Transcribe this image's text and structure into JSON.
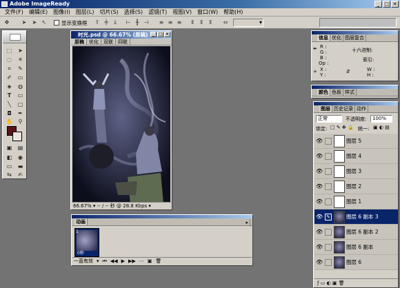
{
  "app": {
    "title": "Adobe ImageReady"
  },
  "menu": [
    "文件(F)",
    "编辑(E)",
    "图像(I)",
    "图层(L)",
    "切片(S)",
    "选择(S)",
    "滤镜(T)",
    "视图(V)",
    "窗口(W)",
    "帮助(H)"
  ],
  "options": {
    "show_transform_label": "显示变换框"
  },
  "document": {
    "title": "时光.psd @ 66.67% (原稿)",
    "tabs": [
      "原稿",
      "优化",
      "双联",
      "四联"
    ],
    "zoom": "66.67%",
    "status": "-- / -- 秒 @ 28.8 Kbps"
  },
  "animation": {
    "title": "动画",
    "frame_number": "1",
    "frame_delay": "0秒",
    "loop": "一直有效"
  },
  "info_panel": {
    "tabs": [
      "信息",
      "优化",
      "图层复合"
    ],
    "labels": {
      "r": "R :",
      "g": "G :",
      "b": "B :",
      "op": "Op :",
      "hex": "十六进制:",
      "index": "索引:",
      "x": "X :",
      "y": "Y :",
      "w": "W :",
      "h": "H :"
    }
  },
  "color_panel": {
    "tabs": [
      "颜色",
      "色板",
      "样式"
    ]
  },
  "layers_panel": {
    "tabs": [
      "图层",
      "历史记录",
      "动作"
    ],
    "blend_mode": "正常",
    "opacity_label": "不透明度:",
    "opacity": "100%",
    "lock_label": "锁定:",
    "unify_label": "统一:",
    "layers": [
      {
        "name": "图层 5",
        "thumb": "light",
        "selected": false
      },
      {
        "name": "图层 4",
        "thumb": "light",
        "selected": false
      },
      {
        "name": "图层 3",
        "thumb": "light",
        "selected": false
      },
      {
        "name": "图层 2",
        "thumb": "light",
        "selected": false
      },
      {
        "name": "图层 1",
        "thumb": "light",
        "selected": false
      },
      {
        "name": "图层 6 副本 3",
        "thumb": "dark",
        "selected": true
      },
      {
        "name": "图层 6 副本 2",
        "thumb": "dark",
        "selected": false
      },
      {
        "name": "图层 6 副本",
        "thumb": "dark",
        "selected": false
      },
      {
        "name": "图层 6",
        "thumb": "dark",
        "selected": false
      }
    ]
  },
  "colors": {
    "workspace": "#737373",
    "chrome": "#d4d0c8",
    "title_active": "#0a246a",
    "selection": "#0a246a",
    "foreground_swatch": "#5a1418",
    "background_swatch": "#e9e4e0"
  }
}
